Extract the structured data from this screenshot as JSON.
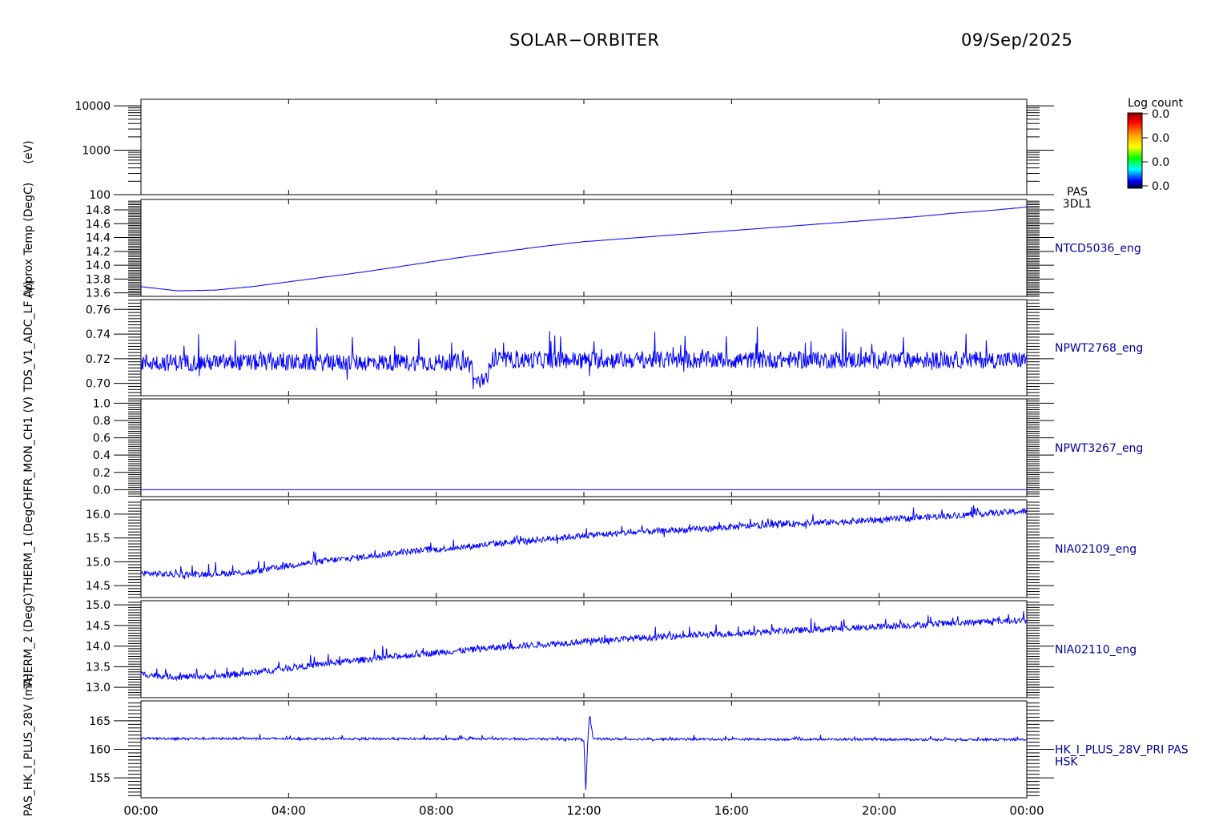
{
  "header": {
    "title": "SOLAR−ORBITER",
    "date": "09/Sep/2025"
  },
  "colorbar": {
    "title": "Log count",
    "labels": [
      "0.0",
      "0.0",
      "0.0",
      "0.0"
    ],
    "colors": [
      "#ff0000",
      "#ffa500",
      "#ffff00",
      "#00ff00",
      "#00ffff",
      "#0000ff",
      "#000040"
    ]
  },
  "colors": {
    "trace": "#0000ff",
    "frame": "#000000",
    "label": "#00009c"
  },
  "chart_data": [
    {
      "type": "heatmap",
      "panel": "PAS 3DL1",
      "ylabel": "(eV)",
      "yscale": "log",
      "ylim": [
        100,
        14000
      ],
      "yticks": [
        {
          "v": 100,
          "t": "100"
        },
        {
          "v": 1000,
          "t": "1000"
        },
        {
          "v": 10000,
          "t": "10000"
        }
      ],
      "right_label": [
        "PAS",
        "3DL1"
      ],
      "values": []
    },
    {
      "type": "line",
      "ylabel": "Approx Temp (DegC)",
      "ylim": [
        13.55,
        14.95
      ],
      "yticks": [
        {
          "v": 13.6,
          "t": "13.6"
        },
        {
          "v": 13.8,
          "t": "13.8"
        },
        {
          "v": 14.0,
          "t": "14.0"
        },
        {
          "v": 14.2,
          "t": "14.2"
        },
        {
          "v": 14.4,
          "t": "14.4"
        },
        {
          "v": 14.6,
          "t": "14.6"
        },
        {
          "v": 14.8,
          "t": "14.8"
        }
      ],
      "right_label": [
        "NTCD5036_eng"
      ],
      "series": [
        {
          "x": [
            0,
            1,
            2,
            3,
            4,
            5,
            6,
            7,
            8,
            9,
            10,
            11,
            12,
            13,
            14,
            15,
            16,
            17,
            18,
            19,
            20,
            21,
            22,
            23,
            24
          ],
          "y": [
            13.69,
            13.63,
            13.64,
            13.69,
            13.76,
            13.83,
            13.9,
            13.98,
            14.06,
            14.14,
            14.21,
            14.28,
            14.34,
            14.38,
            14.42,
            14.46,
            14.5,
            14.54,
            14.58,
            14.62,
            14.66,
            14.7,
            14.75,
            14.79,
            14.84
          ],
          "noise": 0.004
        }
      ]
    },
    {
      "type": "line",
      "ylabel": "TDS_V1_ADC_LF (V)",
      "ylim": [
        0.69,
        0.768
      ],
      "yticks": [
        {
          "v": 0.7,
          "t": "0.70"
        },
        {
          "v": 0.72,
          "t": "0.72"
        },
        {
          "v": 0.74,
          "t": "0.74"
        },
        {
          "v": 0.76,
          "t": "0.76"
        }
      ],
      "right_label": [
        "NPWT2768_eng"
      ],
      "series": [
        {
          "x": [
            0,
            8.95,
            9.0,
            9.4,
            9.45,
            24
          ],
          "y": [
            0.717,
            0.717,
            0.702,
            0.702,
            0.719,
            0.719
          ],
          "noise": 0.014
        }
      ]
    },
    {
      "type": "line",
      "ylabel": "HFR_MON_CH1 (V)",
      "ylim": [
        -0.08,
        1.05
      ],
      "yticks": [
        {
          "v": 0.0,
          "t": "0.0"
        },
        {
          "v": 0.2,
          "t": "0.2"
        },
        {
          "v": 0.4,
          "t": "0.4"
        },
        {
          "v": 0.6,
          "t": "0.6"
        },
        {
          "v": 0.8,
          "t": "0.8"
        },
        {
          "v": 1.0,
          "t": "1.0"
        }
      ],
      "right_label": [
        "NPWT3267_eng"
      ],
      "series": [
        {
          "x": [
            0,
            24
          ],
          "y": [
            0.0,
            0.0
          ],
          "noise": 0.0
        }
      ]
    },
    {
      "type": "line",
      "ylabel": "THERM_1 (DegC)",
      "ylim": [
        14.25,
        16.3
      ],
      "yticks": [
        {
          "v": 14.5,
          "t": "14.5"
        },
        {
          "v": 15.0,
          "t": "15.0"
        },
        {
          "v": 15.5,
          "t": "15.5"
        },
        {
          "v": 16.0,
          "t": "16.0"
        }
      ],
      "right_label": [
        "NIA02109_eng"
      ],
      "series": [
        {
          "x": [
            0,
            1,
            2,
            3,
            4,
            5,
            6,
            7,
            8,
            9,
            10,
            11,
            12,
            13,
            14,
            15,
            16,
            17,
            18,
            19,
            20,
            21,
            22,
            23,
            24
          ],
          "y": [
            14.76,
            14.73,
            14.75,
            14.78,
            14.92,
            15.02,
            15.1,
            15.2,
            15.26,
            15.33,
            15.41,
            15.48,
            15.55,
            15.6,
            15.64,
            15.68,
            15.73,
            15.77,
            15.81,
            15.84,
            15.88,
            15.92,
            15.97,
            16.02,
            16.06
          ],
          "noise": 0.13
        }
      ]
    },
    {
      "type": "line",
      "ylabel": "THERM_2 (DegC)",
      "ylim": [
        12.75,
        15.1
      ],
      "yticks": [
        {
          "v": 13.0,
          "t": "13.0"
        },
        {
          "v": 13.5,
          "t": "13.5"
        },
        {
          "v": 14.0,
          "t": "14.0"
        },
        {
          "v": 14.5,
          "t": "14.5"
        },
        {
          "v": 15.0,
          "t": "15.0"
        }
      ],
      "right_label": [
        "NIA02110_eng"
      ],
      "series": [
        {
          "x": [
            0,
            1,
            2,
            3,
            4,
            5,
            6,
            7,
            8,
            9,
            10,
            11,
            12,
            13,
            14,
            15,
            16,
            17,
            18,
            19,
            20,
            21,
            22,
            23,
            24
          ],
          "y": [
            13.32,
            13.25,
            13.27,
            13.35,
            13.47,
            13.57,
            13.67,
            13.76,
            13.84,
            13.92,
            13.99,
            14.05,
            14.11,
            14.17,
            14.22,
            14.26,
            14.3,
            14.35,
            14.39,
            14.43,
            14.47,
            14.51,
            14.55,
            14.6,
            14.63
          ],
          "noise": 0.15
        }
      ]
    },
    {
      "type": "line",
      "ylabel": "PAS_HK_I_PLUS_28V (mA)",
      "ylim": [
        151.5,
        168.5
      ],
      "yticks": [
        {
          "v": 155,
          "t": "155"
        },
        {
          "v": 160,
          "t": "160"
        },
        {
          "v": 165,
          "t": "165"
        }
      ],
      "right_label": [
        "HK_I_PLUS_28V_PRI PAS",
        "HSK"
      ],
      "series": [
        {
          "x": [
            0,
            11.9,
            12.0,
            12.05,
            12.1,
            12.15,
            12.25,
            12.35,
            24
          ],
          "y": [
            161.9,
            161.8,
            161.5,
            152.8,
            160.5,
            166.3,
            161.9,
            161.8,
            161.7
          ],
          "noise": 0.4
        }
      ]
    }
  ],
  "xaxis": {
    "ticks": [
      {
        "v": 0,
        "t": "00:00"
      },
      {
        "v": 4,
        "t": "04:00"
      },
      {
        "v": 8,
        "t": "08:00"
      },
      {
        "v": 12,
        "t": "12:00"
      },
      {
        "v": 16,
        "t": "16:00"
      },
      {
        "v": 20,
        "t": "20:00"
      },
      {
        "v": 24,
        "t": "00:00"
      }
    ],
    "xlim": [
      0,
      24
    ]
  }
}
